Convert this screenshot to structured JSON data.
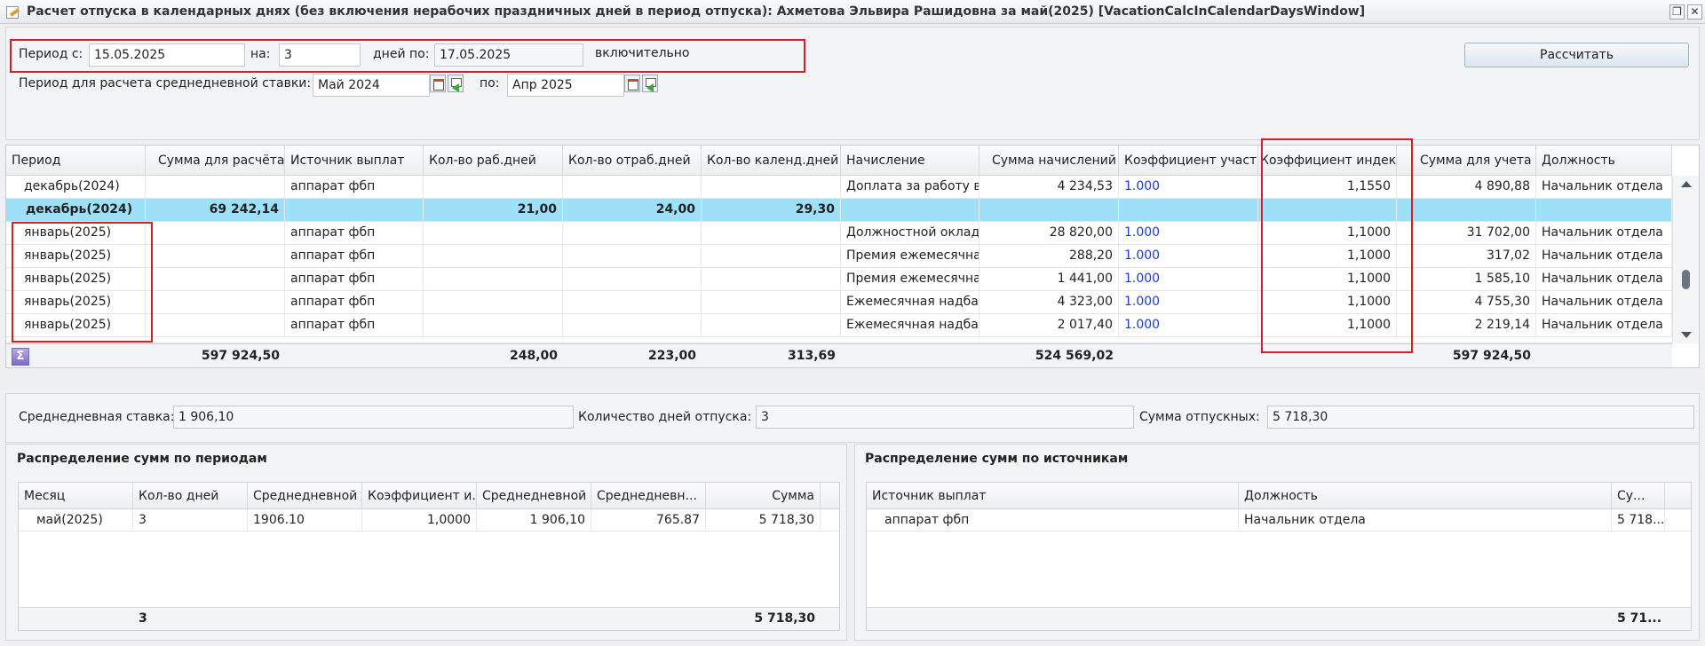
{
  "window": {
    "title": "Расчет отпуска в календарных днях (без включения нерабочих праздничных дней в период отпуска): Ахметова Эльвира Рашидовна за май(2025) [VacationCalcInCalendarDaysWindow]",
    "restore_icon": "restore-window-icon",
    "close_icon": "close-icon"
  },
  "period": {
    "from_label": "Период с:",
    "from_value": "15.05.2025",
    "days_label": "на:",
    "days_value": "3",
    "to_label": "дней по:",
    "to_value": "17.05.2025",
    "inclusive_label": "включительно",
    "calc_button": "Рассчитать"
  },
  "avg_period": {
    "label": "Период для расчета среднедневной ставки:",
    "from_value": "Май 2024",
    "to_label": "по:",
    "to_value": "Апр 2025"
  },
  "grid": {
    "columns": [
      "Период",
      "Сумма для расчёта",
      "Источник выплат",
      "Кол-во раб.дней",
      "Кол-во отраб.дней",
      "Кол-во календ.дней",
      "Начисление",
      "Сумма начислений",
      "Коэффициент участия",
      "Коэффициент индек...",
      "Сумма для учета",
      "Должность"
    ],
    "rows": [
      {
        "period": "декабрь(2024)",
        "sum_calc": "",
        "source": "аппарат фбп",
        "work_days": "",
        "worked_days": "",
        "cal_days": "",
        "accrual": "Доплата за работу в...",
        "accrual_sum": "4 234,53",
        "part_coef": "1.000",
        "index_coef": "1,1550",
        "sum_account": "4 890,88",
        "position": "Начальник отдела"
      },
      {
        "period": "декабрь(2024)",
        "sum_calc": "69 242,14",
        "source": "",
        "work_days": "21,00",
        "worked_days": "24,00",
        "cal_days": "29,30",
        "accrual": "",
        "accrual_sum": "",
        "part_coef": "",
        "index_coef": "",
        "sum_account": "",
        "position": ""
      },
      {
        "period": "январь(2025)",
        "sum_calc": "",
        "source": "аппарат фбп",
        "work_days": "",
        "worked_days": "",
        "cal_days": "",
        "accrual": "Должностной оклад",
        "accrual_sum": "28 820,00",
        "part_coef": "1.000",
        "index_coef": "1,1000",
        "sum_account": "31 702,00",
        "position": "Начальник отдела"
      },
      {
        "period": "январь(2025)",
        "sum_calc": "",
        "source": "аппарат фбп",
        "work_days": "",
        "worked_days": "",
        "cal_days": "",
        "accrual": "Премия ежемесячна...",
        "accrual_sum": "288,20",
        "part_coef": "1.000",
        "index_coef": "1,1000",
        "sum_account": "317,02",
        "position": "Начальник отдела"
      },
      {
        "period": "январь(2025)",
        "sum_calc": "",
        "source": "аппарат фбп",
        "work_days": "",
        "worked_days": "",
        "cal_days": "",
        "accrual": "Премия ежемесячна...",
        "accrual_sum": "1 441,00",
        "part_coef": "1.000",
        "index_coef": "1,1000",
        "sum_account": "1 585,10",
        "position": "Начальник отдела"
      },
      {
        "period": "январь(2025)",
        "sum_calc": "",
        "source": "аппарат фбп",
        "work_days": "",
        "worked_days": "",
        "cal_days": "",
        "accrual": "Ежемесячная надба...",
        "accrual_sum": "4 323,00",
        "part_coef": "1.000",
        "index_coef": "1,1000",
        "sum_account": "4 755,30",
        "position": "Начальник отдела"
      },
      {
        "period": "январь(2025)",
        "sum_calc": "",
        "source": "аппарат фбп",
        "work_days": "",
        "worked_days": "",
        "cal_days": "",
        "accrual": "Ежемесячная надба...",
        "accrual_sum": "2 017,40",
        "part_coef": "1.000",
        "index_coef": "1,1000",
        "sum_account": "2 219,14",
        "position": "Начальник отдела"
      }
    ],
    "totals": {
      "sum_calc": "597 924,50",
      "work_days": "248,00",
      "worked_days": "223,00",
      "cal_days": "313,69",
      "accrual_sum": "524 569,02",
      "sum_account": "597 924,50"
    },
    "sum_icon": "Σ"
  },
  "summary": {
    "avg_rate_label": "Среднедневная ставка:",
    "avg_rate_value": "1 906,10",
    "days_label": "Количество дней отпуска:",
    "days_value": "3",
    "vacation_sum_label": "Сумма отпускных:",
    "vacation_sum_value": "5 718,30"
  },
  "by_period": {
    "title": "Распределение сумм по периодам",
    "columns": [
      "Месяц",
      "Кол-во дней",
      "Среднедневной ...",
      "Коэффициент и...",
      "Среднедневной ...",
      "Среднедневн...",
      "Сумма"
    ],
    "row": [
      "май(2025)",
      "3",
      "1906.10",
      "1,0000",
      "1 906,10",
      "765.87",
      "5 718,30"
    ],
    "total_days": "3",
    "total_sum": "5 718,30"
  },
  "by_source": {
    "title": "Распределение сумм по источникам",
    "columns": [
      "Источник выплат",
      "Должность",
      "Су..."
    ],
    "row": [
      "аппарат фбп",
      "Начальник отдела",
      "5 718..."
    ],
    "total_sum": "5 71..."
  }
}
